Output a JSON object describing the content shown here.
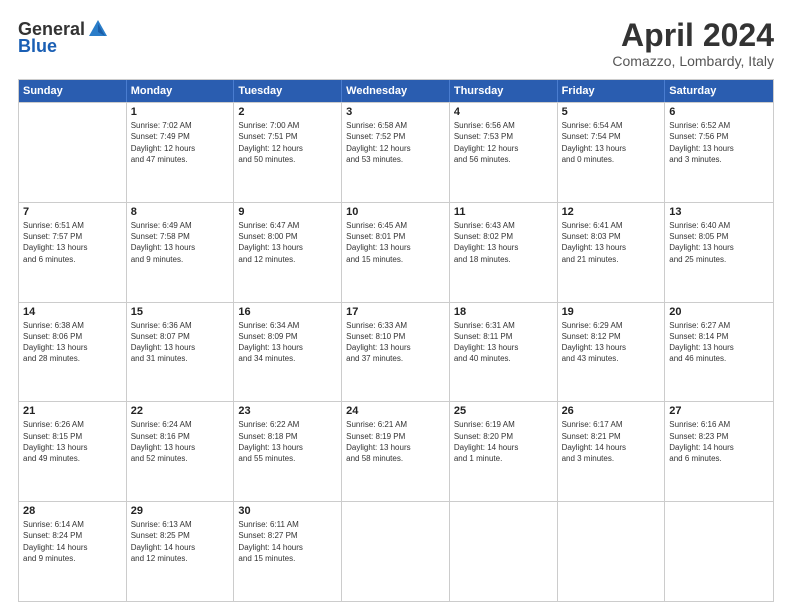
{
  "header": {
    "logo": {
      "general": "General",
      "blue": "Blue"
    },
    "title": "April 2024",
    "subtitle": "Comazzo, Lombardy, Italy"
  },
  "weekdays": [
    "Sunday",
    "Monday",
    "Tuesday",
    "Wednesday",
    "Thursday",
    "Friday",
    "Saturday"
  ],
  "weeks": [
    [
      {
        "day": "",
        "info": ""
      },
      {
        "day": "1",
        "info": "Sunrise: 7:02 AM\nSunset: 7:49 PM\nDaylight: 12 hours\nand 47 minutes."
      },
      {
        "day": "2",
        "info": "Sunrise: 7:00 AM\nSunset: 7:51 PM\nDaylight: 12 hours\nand 50 minutes."
      },
      {
        "day": "3",
        "info": "Sunrise: 6:58 AM\nSunset: 7:52 PM\nDaylight: 12 hours\nand 53 minutes."
      },
      {
        "day": "4",
        "info": "Sunrise: 6:56 AM\nSunset: 7:53 PM\nDaylight: 12 hours\nand 56 minutes."
      },
      {
        "day": "5",
        "info": "Sunrise: 6:54 AM\nSunset: 7:54 PM\nDaylight: 13 hours\nand 0 minutes."
      },
      {
        "day": "6",
        "info": "Sunrise: 6:52 AM\nSunset: 7:56 PM\nDaylight: 13 hours\nand 3 minutes."
      }
    ],
    [
      {
        "day": "7",
        "info": "Sunrise: 6:51 AM\nSunset: 7:57 PM\nDaylight: 13 hours\nand 6 minutes."
      },
      {
        "day": "8",
        "info": "Sunrise: 6:49 AM\nSunset: 7:58 PM\nDaylight: 13 hours\nand 9 minutes."
      },
      {
        "day": "9",
        "info": "Sunrise: 6:47 AM\nSunset: 8:00 PM\nDaylight: 13 hours\nand 12 minutes."
      },
      {
        "day": "10",
        "info": "Sunrise: 6:45 AM\nSunset: 8:01 PM\nDaylight: 13 hours\nand 15 minutes."
      },
      {
        "day": "11",
        "info": "Sunrise: 6:43 AM\nSunset: 8:02 PM\nDaylight: 13 hours\nand 18 minutes."
      },
      {
        "day": "12",
        "info": "Sunrise: 6:41 AM\nSunset: 8:03 PM\nDaylight: 13 hours\nand 21 minutes."
      },
      {
        "day": "13",
        "info": "Sunrise: 6:40 AM\nSunset: 8:05 PM\nDaylight: 13 hours\nand 25 minutes."
      }
    ],
    [
      {
        "day": "14",
        "info": "Sunrise: 6:38 AM\nSunset: 8:06 PM\nDaylight: 13 hours\nand 28 minutes."
      },
      {
        "day": "15",
        "info": "Sunrise: 6:36 AM\nSunset: 8:07 PM\nDaylight: 13 hours\nand 31 minutes."
      },
      {
        "day": "16",
        "info": "Sunrise: 6:34 AM\nSunset: 8:09 PM\nDaylight: 13 hours\nand 34 minutes."
      },
      {
        "day": "17",
        "info": "Sunrise: 6:33 AM\nSunset: 8:10 PM\nDaylight: 13 hours\nand 37 minutes."
      },
      {
        "day": "18",
        "info": "Sunrise: 6:31 AM\nSunset: 8:11 PM\nDaylight: 13 hours\nand 40 minutes."
      },
      {
        "day": "19",
        "info": "Sunrise: 6:29 AM\nSunset: 8:12 PM\nDaylight: 13 hours\nand 43 minutes."
      },
      {
        "day": "20",
        "info": "Sunrise: 6:27 AM\nSunset: 8:14 PM\nDaylight: 13 hours\nand 46 minutes."
      }
    ],
    [
      {
        "day": "21",
        "info": "Sunrise: 6:26 AM\nSunset: 8:15 PM\nDaylight: 13 hours\nand 49 minutes."
      },
      {
        "day": "22",
        "info": "Sunrise: 6:24 AM\nSunset: 8:16 PM\nDaylight: 13 hours\nand 52 minutes."
      },
      {
        "day": "23",
        "info": "Sunrise: 6:22 AM\nSunset: 8:18 PM\nDaylight: 13 hours\nand 55 minutes."
      },
      {
        "day": "24",
        "info": "Sunrise: 6:21 AM\nSunset: 8:19 PM\nDaylight: 13 hours\nand 58 minutes."
      },
      {
        "day": "25",
        "info": "Sunrise: 6:19 AM\nSunset: 8:20 PM\nDaylight: 14 hours\nand 1 minute."
      },
      {
        "day": "26",
        "info": "Sunrise: 6:17 AM\nSunset: 8:21 PM\nDaylight: 14 hours\nand 3 minutes."
      },
      {
        "day": "27",
        "info": "Sunrise: 6:16 AM\nSunset: 8:23 PM\nDaylight: 14 hours\nand 6 minutes."
      }
    ],
    [
      {
        "day": "28",
        "info": "Sunrise: 6:14 AM\nSunset: 8:24 PM\nDaylight: 14 hours\nand 9 minutes."
      },
      {
        "day": "29",
        "info": "Sunrise: 6:13 AM\nSunset: 8:25 PM\nDaylight: 14 hours\nand 12 minutes."
      },
      {
        "day": "30",
        "info": "Sunrise: 6:11 AM\nSunset: 8:27 PM\nDaylight: 14 hours\nand 15 minutes."
      },
      {
        "day": "",
        "info": ""
      },
      {
        "day": "",
        "info": ""
      },
      {
        "day": "",
        "info": ""
      },
      {
        "day": "",
        "info": ""
      }
    ]
  ]
}
